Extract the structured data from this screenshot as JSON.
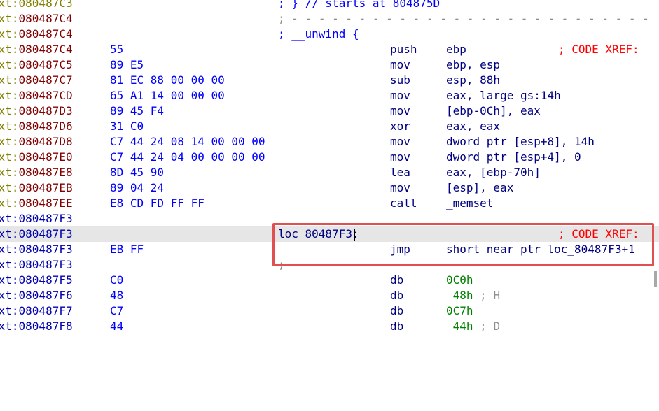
{
  "colors": {
    "segment_prefix": "#808000",
    "address": "#800000",
    "bytes": "#0000ff",
    "instr": "#000080",
    "xref": "#ff0000",
    "highlight_box": "#e05050"
  },
  "lines": [
    {
      "seg": "ext:",
      "addr": "080487C3",
      "bytes": "",
      "label": "",
      "mnem": "",
      "ops": "",
      "comment_top": "; } // starts at 804875D",
      "xref": ""
    },
    {
      "seg": "ext:",
      "addr": "080487C4",
      "bytes": "",
      "label": "",
      "mnem": "",
      "ops": "",
      "comment_top": ";",
      "xref": ""
    },
    {
      "seg": "ext:",
      "addr": "080487C4",
      "bytes": "",
      "label": "",
      "mnem": "",
      "ops": "",
      "comment_top": "; __unwind {",
      "xref": ""
    },
    {
      "seg": "ext:",
      "addr": "080487C4",
      "bytes": "55",
      "mnem": "push",
      "ops": "ebp",
      "xref": "; CODE XREF:"
    },
    {
      "seg": "ext:",
      "addr": "080487C5",
      "bytes": "89 E5",
      "mnem": "mov",
      "ops": "ebp, esp"
    },
    {
      "seg": "ext:",
      "addr": "080487C7",
      "bytes": "81 EC 88 00 00 00",
      "mnem": "sub",
      "ops": "esp, 88h"
    },
    {
      "seg": "ext:",
      "addr": "080487CD",
      "bytes": "65 A1 14 00 00 00",
      "mnem": "mov",
      "ops": "eax, large gs:14h"
    },
    {
      "seg": "ext:",
      "addr": "080487D3",
      "bytes": "89 45 F4",
      "mnem": "mov",
      "ops": "[ebp-0Ch], eax"
    },
    {
      "seg": "ext:",
      "addr": "080487D6",
      "bytes": "31 C0",
      "mnem": "xor",
      "ops": "eax, eax"
    },
    {
      "seg": "ext:",
      "addr": "080487D8",
      "bytes": "C7 44 24 08 14 00 00 00",
      "mnem": "mov",
      "ops": "dword ptr [esp+8], 14h"
    },
    {
      "seg": "ext:",
      "addr": "080487E0",
      "bytes": "C7 44 24 04 00 00 00 00",
      "mnem": "mov",
      "ops": "dword ptr [esp+4], 0"
    },
    {
      "seg": "ext:",
      "addr": "080487E8",
      "bytes": "8D 45 90",
      "mnem": "lea",
      "ops": "eax, [ebp-70h]"
    },
    {
      "seg": "ext:",
      "addr": "080487EB",
      "bytes": "89 04 24",
      "mnem": "mov",
      "ops": "[esp], eax"
    },
    {
      "seg": "ext:",
      "addr": "080487EE",
      "bytes": "E8 CD FD FF FF",
      "mnem": "call",
      "ops": "_memset"
    },
    {
      "seg": "ext:",
      "addr": "080487F3",
      "bytes": ""
    },
    {
      "seg": "ext:",
      "addr": "080487F3",
      "label": "loc_80487F3:",
      "xref": "; CODE XREF:"
    },
    {
      "seg": "ext:",
      "addr": "080487F3",
      "bytes": "EB FF",
      "mnem": "jmp",
      "ops": "short near ptr loc_80487F3+1"
    },
    {
      "seg": "ext:",
      "addr": "080487F3",
      "comment_top": ";"
    },
    {
      "seg": "ext:",
      "addr": "080487F5",
      "bytes": "C0",
      "mnem": "db",
      "ops": "0C0h"
    },
    {
      "seg": "ext:",
      "addr": "080487F6",
      "bytes": "48",
      "mnem": "db",
      "ops": " 48h",
      "trail": "; H"
    },
    {
      "seg": "ext:",
      "addr": "080487F7",
      "bytes": "C7",
      "mnem": "db",
      "ops": "0C7h"
    },
    {
      "seg": "ext:",
      "addr": "080487F8",
      "bytes": "44",
      "mnem": "db",
      "ops": " 44h",
      "trail": "; D"
    }
  ],
  "separator_dashes": "- - - - - - - - - - - - - - - - - - - - - - - - - - -"
}
